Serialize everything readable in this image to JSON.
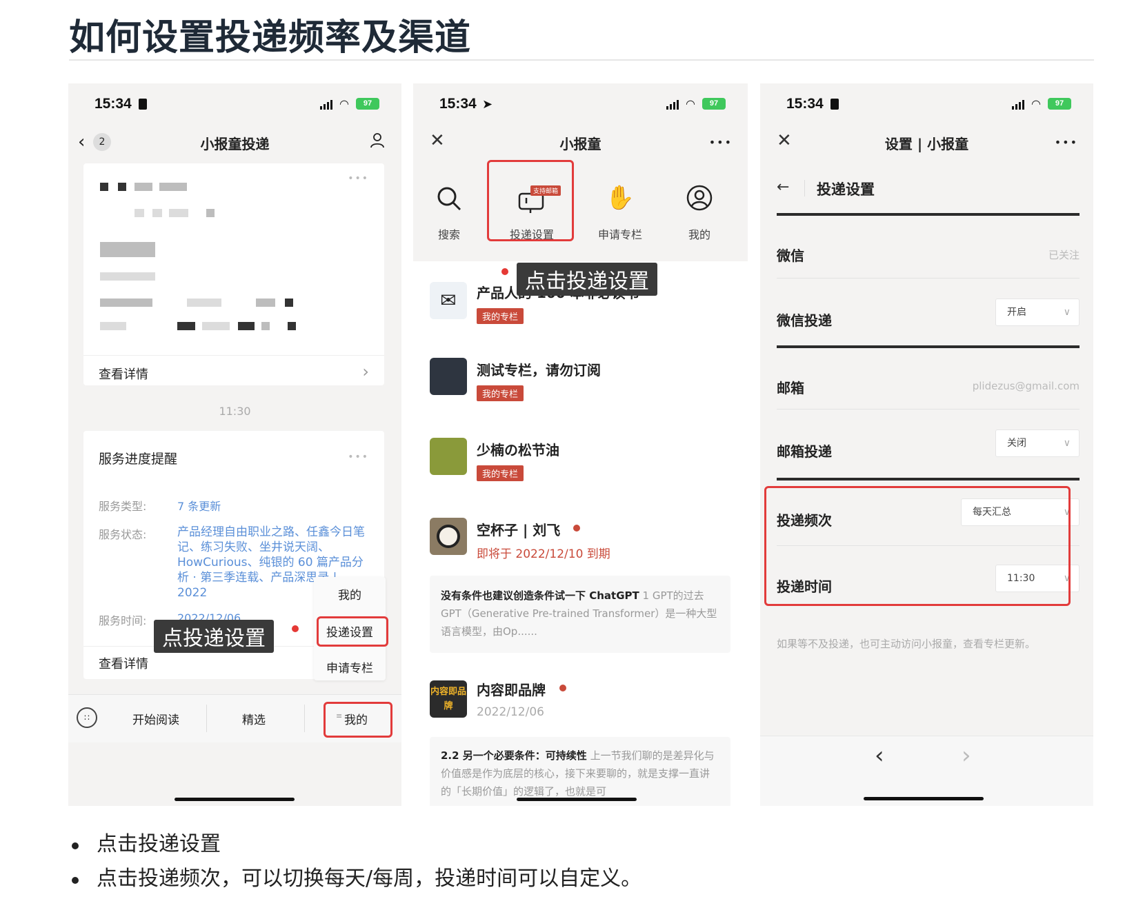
{
  "page": {
    "title": "如何设置投递频率及渠道",
    "bullets": [
      "点击投递设置",
      "点击投递频次，可以切换每天/每周，投递时间可以自定义。"
    ]
  },
  "colors": {
    "accent_red": "#e23b3b",
    "tag_red": "#c94a3a",
    "battery_green": "#3fc85c"
  },
  "phone1": {
    "time": "15:34",
    "battery": "97",
    "back_count": "2",
    "nav_title": "小报童投递",
    "card1_more": "•••",
    "card1_detail": "查看详情",
    "timestamp": "11:30",
    "card2_title": "服务进度提醒",
    "card2_more": "•••",
    "service_type_label": "服务类型:",
    "service_type_value": "7 条更新",
    "service_status_label": "服务状态:",
    "service_status_value": "产品经理自由职业之路、任鑫今日笔记、练习失败、坐井说天阔、HowCurious、纯银的 60 篇产品分析 · 第三季连载、产品深思录 | 2022",
    "service_time_label": "服务时间:",
    "service_time_value": "2022/12/06",
    "card2_detail": "查看详情",
    "popup_menu": [
      "我的",
      "投递设置",
      "申请专栏"
    ],
    "tooltip": "点投递设置",
    "tabs": [
      "开始阅读",
      "精选",
      "我的"
    ]
  },
  "phone2": {
    "time": "15:34",
    "battery": "97",
    "nav_title": "小报童",
    "nav_more": "•••",
    "actions": [
      {
        "label": "搜索",
        "icon": "search-icon"
      },
      {
        "label": "投递设置",
        "icon": "mailbox-icon",
        "badge": "支持邮箱"
      },
      {
        "label": "申请专栏",
        "icon": "hand-icon"
      },
      {
        "label": "我的",
        "icon": "user-circle-icon"
      }
    ],
    "tooltip": "点击投递设置",
    "list": [
      {
        "title": "产品人的 100 本非必读书",
        "tag": "我的专栏"
      },
      {
        "title": "测试专栏，请勿订阅",
        "tag": "我的专栏"
      },
      {
        "title": "少楠の松节油",
        "tag": "我的专栏"
      },
      {
        "title": "空杯子 | 刘飞",
        "sub": "即将于 2022/12/10 到期"
      }
    ],
    "article1_bold": "没有条件也建议创造条件试一下 ChatGPT",
    "article1_rest": " 1 GPT的过去GPT（Generative Pre-trained Transformer）是一种大型语言模型，由Op......",
    "brand_title": "内容即品牌",
    "brand_avatar": "内容即品牌",
    "brand_date": "2022/12/06",
    "article2_bold": "2.2 另一个必要条件：可持续性",
    "article2_rest": " 上一节我们聊的是差异化与价值感是作为底层的核心，接下来要聊的，就是支撑一直讲的「长期价值」的逻辑了，也就是可"
  },
  "phone3": {
    "time": "15:34",
    "battery": "97",
    "nav_title": "设置 | 小报童",
    "nav_more": "•••",
    "section_title": "投递设置",
    "rows": {
      "wechat_label": "微信",
      "wechat_value": "已关注",
      "wechat_push_label": "微信投递",
      "wechat_push_value": "开启",
      "email_label": "邮箱",
      "email_value": "plidezus@gmail.com",
      "email_push_label": "邮箱投递",
      "email_push_value": "关闭",
      "freq_label": "投递频次",
      "freq_value": "每天汇总",
      "time_label": "投递时间",
      "time_value": "11:30"
    },
    "note": "如果等不及投递，也可主动访问小报童，查看专栏更新。"
  }
}
